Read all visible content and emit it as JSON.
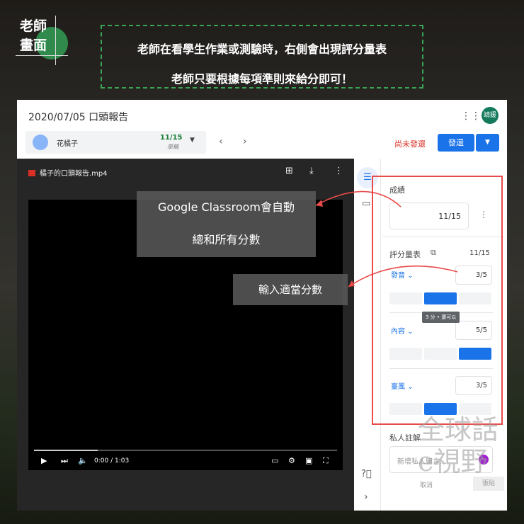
{
  "corner_label": [
    "老師",
    "畫面"
  ],
  "banner": [
    "老師在看學生作業或測驗時，右側會出現評分量表",
    "老師只要根據每項準則來給分即可！"
  ],
  "app": {
    "title": "2020/07/05 口頭報告",
    "avatar": "靖媛",
    "student": {
      "name": "花橘子",
      "score": "11/15",
      "status": "草稿"
    },
    "unsent": "尚未發還",
    "return_label": "發還",
    "file_name": "橘子的口頭報告.mp4",
    "time": "0:00 / 1:03",
    "grade_label": "成績",
    "grade_value": "11/15",
    "rubric_label": "評分量表",
    "rubric_total": "11/15",
    "criteria": [
      {
        "name": "發音",
        "score": "3/5",
        "level": 2
      },
      {
        "name": "內容",
        "score": "5/5",
        "level": 3
      },
      {
        "name": "臺風",
        "score": "3/5",
        "level": 2
      }
    ],
    "tooltip": "3 分 • 還可以",
    "notes_label": "私人註解",
    "notes_placeholder": "新增私人留言...",
    "cancel": "取消",
    "post": "張貼"
  },
  "callouts": [
    "Google Classroom會自動",
    "總和所有分數",
    "輸入適當分數"
  ],
  "watermark": "全球話 e視野",
  "colors": {
    "accent": "#1a73e8",
    "highlight": "#e94b4b",
    "dash": "#3aa655"
  }
}
